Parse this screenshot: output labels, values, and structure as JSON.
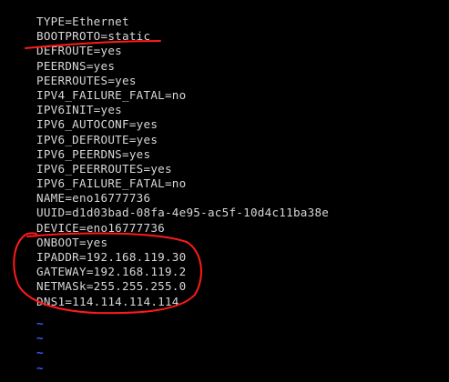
{
  "editor": {
    "lines": [
      "TYPE=Ethernet",
      "BOOTPROTO=static",
      "DEFROUTE=yes",
      "PEERDNS=yes",
      "PEERROUTES=yes",
      "IPV4_FAILURE_FATAL=no",
      "IPV6INIT=yes",
      "IPV6_AUTOCONF=yes",
      "IPV6_DEFROUTE=yes",
      "IPV6_PEERDNS=yes",
      "IPV6_PEERROUTES=yes",
      "IPV6_FAILURE_FATAL=no",
      "NAME=eno16777736",
      "UUID=d1d03bad-08fa-4e95-ac5f-10d4c11ba38e",
      "DEVICE=eno16777736",
      "ONBOOT=yes",
      "IPADDR=192.168.119.30",
      "GATEWAY=192.168.119.2",
      "NETMASk=255.255.255.0",
      "DNS1=114.114.114.114"
    ],
    "empty_line_markers": [
      "~",
      "~",
      "~",
      "~"
    ]
  },
  "colors": {
    "background": "#000000",
    "text": "#d7d7d7",
    "tilde": "#3f5cff",
    "annotation": "#ff1a1a"
  }
}
